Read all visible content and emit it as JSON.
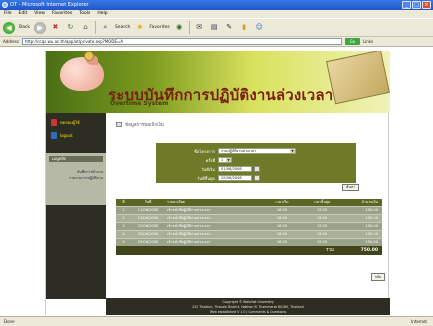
{
  "window": {
    "title": "OT - Microsoft Internet Explorer"
  },
  "menu": [
    "File",
    "Edit",
    "View",
    "Favorites",
    "Tools",
    "Help"
  ],
  "toolbar": {
    "back_label": "Back",
    "search_label": "Search",
    "favorites_label": "Favorites"
  },
  "address": {
    "label": "Address",
    "value": "http://ccqs.wu.ac.th/app/ot/private.asp?MODE=A",
    "go_label": "Go",
    "links_label": "Links"
  },
  "banner": {
    "title": "ระบบบันทึกการปฏิบัติงานล่วงเวลา",
    "subtitle": "Overtime System"
  },
  "nav": {
    "users": [
      "ทดสอบผู้ใช้",
      "logout"
    ],
    "menu_header": "เมนูหลัก",
    "menu_items": [
      "บันทึกการทำงาน",
      "รายงานการปฏิบัติงาน"
    ]
  },
  "crumb": "ข้อมูลการขอเบิกเงิน",
  "form": {
    "rows": [
      {
        "label": "ชื่อโครงการ",
        "value": "งานปฏิบัติงานล่วงเวลา"
      },
      {
        "label": "ครั้งที่",
        "value": "1"
      },
      {
        "label": "วันที่เริ่ม",
        "value": "01/06/2008"
      },
      {
        "label": "วันที่สิ้นสุด",
        "value": "29/06/2008"
      }
    ],
    "search_label": "ค้นหา"
  },
  "table": {
    "headers": [
      "ที่",
      "วันที่",
      "รายละเอียด",
      "เวลาเริ่ม",
      "เวลาสิ้นสุด",
      "จำนวนเงิน"
    ],
    "rows": [
      [
        "1",
        "11/06/2008",
        "เจ้าหน้าที่ปฏิบัติงานล่วงเวลา",
        "16.00",
        "19.00",
        "150.00"
      ],
      [
        "2",
        "15/06/2008",
        "เจ้าหน้าที่ปฏิบัติงานล่วงเวลา",
        "16.00",
        "19.00",
        "150.00"
      ],
      [
        "3",
        "22/06/2008",
        "เจ้าหน้าที่ปฏิบัติงานล่วงเวลา",
        "16.00",
        "19.00",
        "150.00"
      ],
      [
        "4",
        "25/06/2008",
        "เจ้าหน้าที่ปฏิบัติงานล่วงเวลา",
        "16.00",
        "19.00",
        "150.00"
      ],
      [
        "5",
        "29/06/2008",
        "เจ้าหน้าที่ปฏิบัติงานล่วงเวลา",
        "16.00",
        "19.00",
        "150.00"
      ]
    ],
    "total_label": "รวม",
    "total_value": "750.00"
  },
  "back_label": "กลับ",
  "footer": {
    "line1": "Copyright © Walailak University",
    "line2": "222 Thaiburi, Thasala District, Nakhon Si Thammarat 80160, Thailand",
    "line3": "Web established V 1.0 | Comments & Questions"
  },
  "status": {
    "left": "Done",
    "zone": "Internet"
  }
}
